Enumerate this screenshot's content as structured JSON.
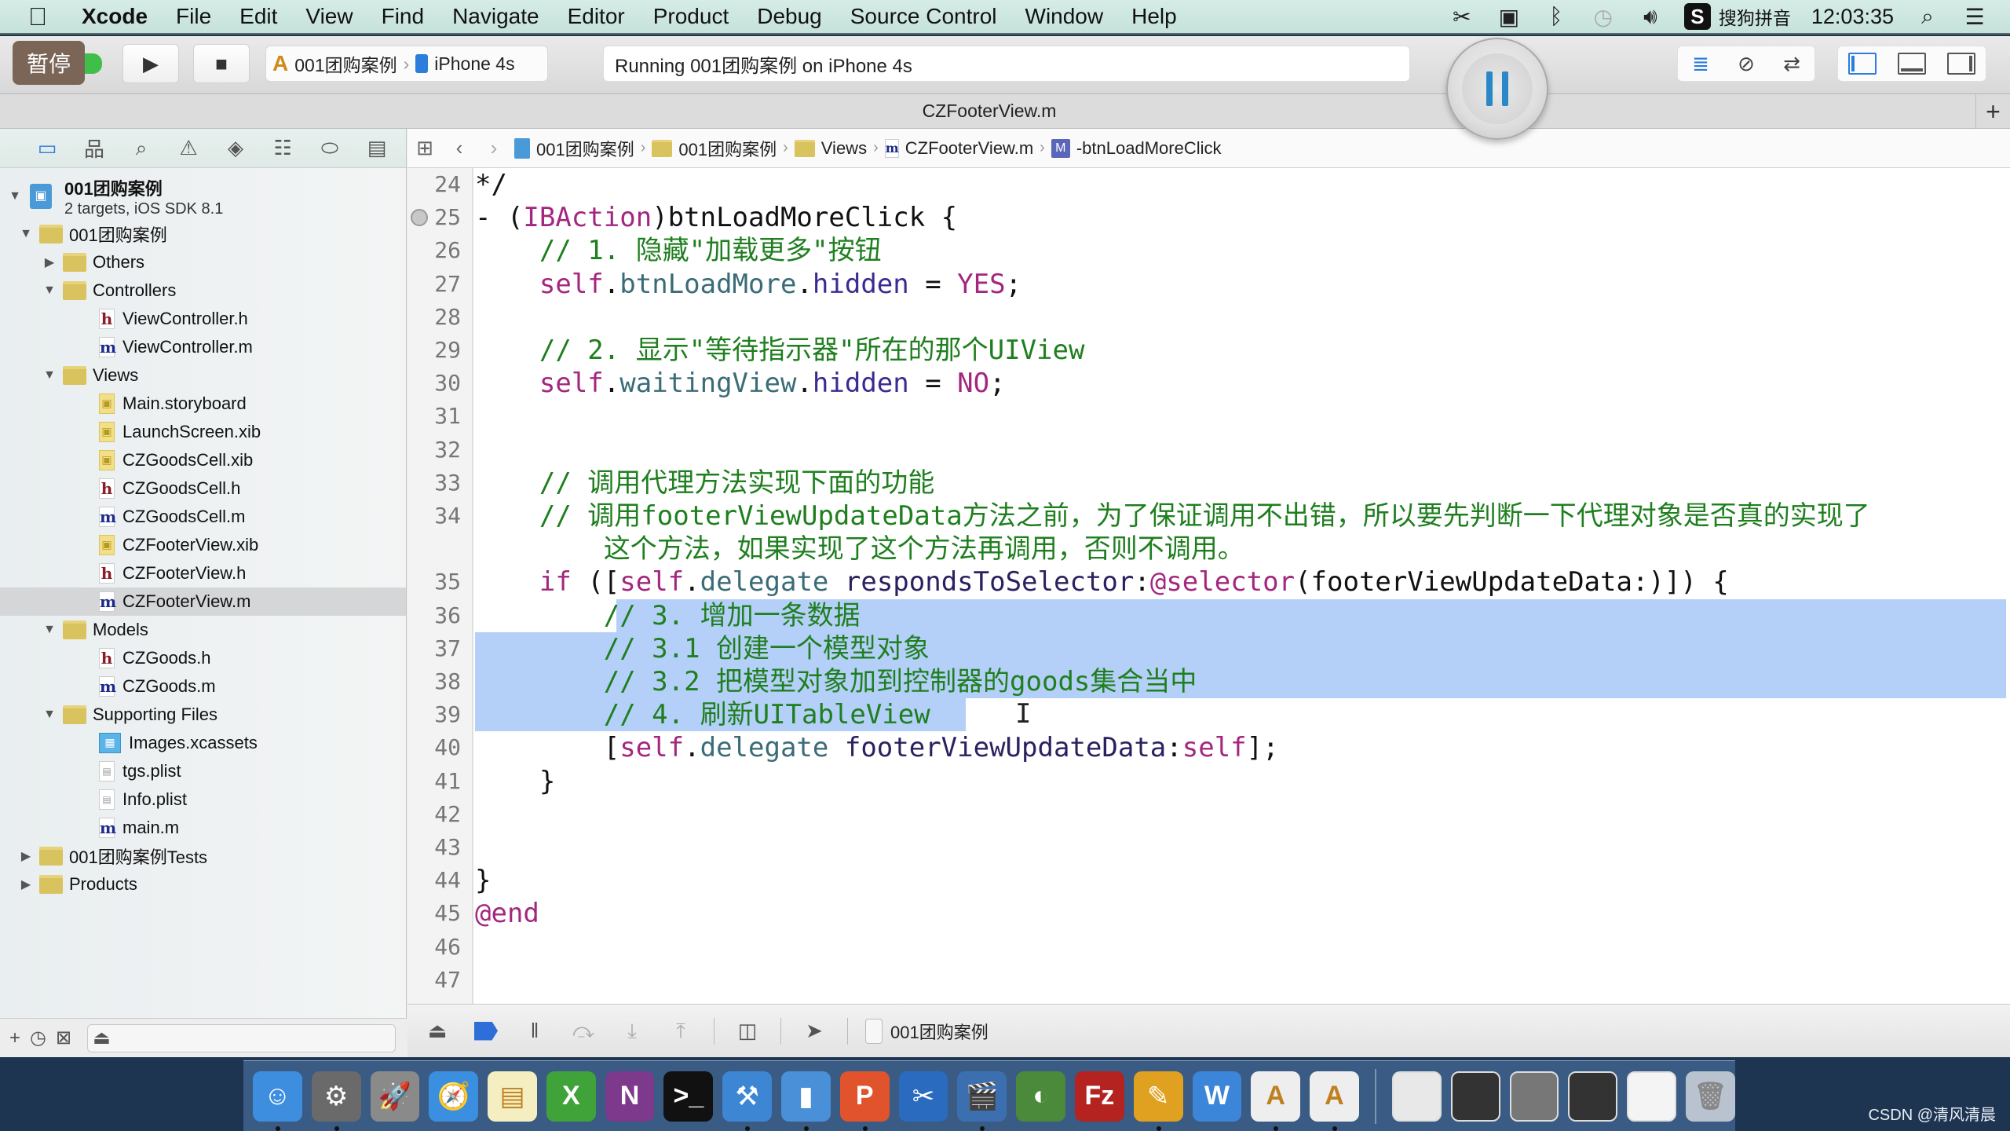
{
  "menubar": {
    "app": "Xcode",
    "menus": [
      "File",
      "Edit",
      "View",
      "Find",
      "Navigate",
      "Editor",
      "Product",
      "Debug",
      "Source Control",
      "Window",
      "Help"
    ],
    "tray": {
      "icons": [
        "scissors-icon",
        "video-camera-icon",
        "bluetooth-icon",
        "time-machine-icon",
        "volume-icon"
      ],
      "ime_badge": "S",
      "ime_label": "搜狗拼音",
      "clock": "12:03:35"
    }
  },
  "toolbar": {
    "pause_tag": "暂停",
    "scheme": "001团购案例",
    "device": "iPhone 4s",
    "status": "Running 001团购案例 on iPhone 4s"
  },
  "tab": {
    "title": "CZFooterView.m",
    "add_label": "+"
  },
  "navigator": {
    "project": {
      "name": "001团购案例",
      "subtitle": "2 targets, iOS SDK 8.1"
    },
    "items": [
      {
        "label": "001团购案例",
        "kind": "folder",
        "depth": 1,
        "open": true
      },
      {
        "label": "Others",
        "kind": "folder",
        "depth": 2,
        "open": false
      },
      {
        "label": "Controllers",
        "kind": "folder",
        "depth": 2,
        "open": true
      },
      {
        "label": "ViewController.h",
        "kind": "h",
        "depth": 3
      },
      {
        "label": "ViewController.m",
        "kind": "m",
        "depth": 3
      },
      {
        "label": "Views",
        "kind": "folder",
        "depth": 2,
        "open": true
      },
      {
        "label": "Main.storyboard",
        "kind": "xib",
        "depth": 3
      },
      {
        "label": "LaunchScreen.xib",
        "kind": "xib",
        "depth": 3
      },
      {
        "label": "CZGoodsCell.xib",
        "kind": "xib",
        "depth": 3
      },
      {
        "label": "CZGoodsCell.h",
        "kind": "h",
        "depth": 3
      },
      {
        "label": "CZGoodsCell.m",
        "kind": "m",
        "depth": 3
      },
      {
        "label": "CZFooterView.xib",
        "kind": "xib",
        "depth": 3
      },
      {
        "label": "CZFooterView.h",
        "kind": "h",
        "depth": 3
      },
      {
        "label": "CZFooterView.m",
        "kind": "m",
        "depth": 3,
        "selected": true
      },
      {
        "label": "Models",
        "kind": "folder",
        "depth": 2,
        "open": true
      },
      {
        "label": "CZGoods.h",
        "kind": "h",
        "depth": 3
      },
      {
        "label": "CZGoods.m",
        "kind": "m",
        "depth": 3
      },
      {
        "label": "Supporting Files",
        "kind": "folder",
        "depth": 2,
        "open": true
      },
      {
        "label": "Images.xcassets",
        "kind": "xcassets",
        "depth": 3
      },
      {
        "label": "tgs.plist",
        "kind": "plist",
        "depth": 3
      },
      {
        "label": "Info.plist",
        "kind": "plist",
        "depth": 3
      },
      {
        "label": "main.m",
        "kind": "m",
        "depth": 3
      },
      {
        "label": "001团购案例Tests",
        "kind": "folder",
        "depth": 1,
        "open": false
      },
      {
        "label": "Products",
        "kind": "folder",
        "depth": 1,
        "open": false
      }
    ]
  },
  "jumpbar": {
    "crumbs": [
      "001团购案例",
      "001团购案例",
      "Views",
      "CZFooterView.m",
      "-btnLoadMoreClick"
    ]
  },
  "editor": {
    "lines": [
      {
        "n": "24",
        "html": "*/"
      },
      {
        "n": "25",
        "breakpoint": true,
        "html": "- (<span class=\"c-kw\">IBAction</span>)btnLoadMoreClick {"
      },
      {
        "n": "26",
        "html": "    <span class=\"c-com\">// 1. 隐藏\"加载更多\"按钮</span>"
      },
      {
        "n": "27",
        "html": "    <span class=\"c-kw\">self</span>.<span class=\"c-var\">btnLoadMore</span>.<span class=\"c-prop\">hidden</span> = <span class=\"c-kw\">YES</span>;"
      },
      {
        "n": "28",
        "html": ""
      },
      {
        "n": "29",
        "html": "    <span class=\"c-com\">// 2. 显示\"等待指示器\"所在的那个UIView</span>"
      },
      {
        "n": "30",
        "html": "    <span class=\"c-kw\">self</span>.<span class=\"c-var\">waitingView</span>.<span class=\"c-prop\">hidden</span> = <span class=\"c-kw\">NO</span>;"
      },
      {
        "n": "31",
        "html": ""
      },
      {
        "n": "32",
        "html": ""
      },
      {
        "n": "33",
        "html": "    <span class=\"c-com\">// 调用代理方法实现下面的功能</span>"
      },
      {
        "n": "34",
        "html": "    <span class=\"c-com\">// 调用footerViewUpdateData方法之前，为了保证调用不出错，所以要先判断一下代理对象是否真的实现了</span>"
      },
      {
        "n": "",
        "html": "        <span class=\"c-com\">这个方法，如果实现了这个方法再调用，否则不调用。</span>"
      },
      {
        "n": "35",
        "html": "    <span class=\"c-kw\">if</span> ([<span class=\"c-kw\">self</span>.<span class=\"c-var\">delegate</span> <span class=\"c-meth\">respondsToSelector</span>:<span class=\"c-kw\">@selector</span>(footerViewUpdateData:)]) {"
      },
      {
        "n": "36",
        "html": "        <span class=\"c-com\">// 3. 增加一条数据</span>"
      },
      {
        "n": "37",
        "html": "        <span class=\"c-com\">// 3.1 创建一个模型对象</span>"
      },
      {
        "n": "38",
        "html": "        <span class=\"c-com\">// 3.2 把模型对象加到控制器的goods集合当中</span>"
      },
      {
        "n": "39",
        "html": "        <span class=\"c-com\">// 4. 刷新UITableView</span>"
      },
      {
        "n": "40",
        "html": "        [<span class=\"c-kw\">self</span>.<span class=\"c-var\">delegate</span> <span class=\"c-meth\">footerViewUpdateData</span>:<span class=\"c-kw\">self</span>];"
      },
      {
        "n": "41",
        "html": "    }"
      },
      {
        "n": "42",
        "html": ""
      },
      {
        "n": "43",
        "html": ""
      },
      {
        "n": "44",
        "html": "}"
      },
      {
        "n": "45",
        "html": "<span class=\"c-kw\">@end</span>"
      },
      {
        "n": "46",
        "html": ""
      },
      {
        "n": "47",
        "html": ""
      }
    ],
    "selection": {
      "from_line": "36",
      "to_line": "39"
    }
  },
  "debugbar": {
    "process": "001团购案例"
  },
  "dock": {
    "apps": [
      {
        "name": "finder",
        "glyph": "☺",
        "color": "#3e8ee0",
        "running": true
      },
      {
        "name": "system-preferences",
        "glyph": "⚙",
        "color": "#6a6a6a",
        "running": true
      },
      {
        "name": "launchpad",
        "glyph": "🚀",
        "color": "#8a8a8a",
        "running": false
      },
      {
        "name": "safari",
        "glyph": "🧭",
        "color": "#3b8fe0",
        "running": false
      },
      {
        "name": "notes",
        "glyph": "▤",
        "color": "#f4eec0",
        "running": false
      },
      {
        "name": "excel",
        "glyph": "X",
        "color": "#3fa33a",
        "running": false
      },
      {
        "name": "onenote",
        "glyph": "N",
        "color": "#7d3a8c",
        "running": false
      },
      {
        "name": "terminal",
        "glyph": ">_",
        "color": "#111111",
        "running": false
      },
      {
        "name": "xcode",
        "glyph": "⚒",
        "color": "#3d86d4",
        "running": true
      },
      {
        "name": "simulator",
        "glyph": "▮",
        "color": "#4a90d8",
        "running": true
      },
      {
        "name": "powerpoint",
        "glyph": "P",
        "color": "#e0532c",
        "running": true
      },
      {
        "name": "snipping-tool",
        "glyph": "✂",
        "color": "#2b6bbf",
        "running": false
      },
      {
        "name": "video-editor",
        "glyph": "🎬",
        "color": "#3c6fb0",
        "running": true
      },
      {
        "name": "recorder",
        "glyph": "◐",
        "color": "#4a8a3a",
        "running": false
      },
      {
        "name": "filezilla",
        "glyph": "Fz",
        "color": "#b4231f",
        "running": false
      },
      {
        "name": "instruments",
        "glyph": "✎",
        "color": "#e0a020",
        "running": true
      },
      {
        "name": "word-doc",
        "glyph": "W",
        "color": "#3b86d8",
        "running": false
      },
      {
        "name": "pdf-preview-1",
        "glyph": "A",
        "color": "#eeeeee",
        "running": true
      },
      {
        "name": "pdf-preview-2",
        "glyph": "A",
        "color": "#eeeeee",
        "running": true
      }
    ],
    "docs": [
      {
        "name": "doc-thumb-1",
        "color": "#e8e8e8"
      },
      {
        "name": "doc-thumb-2",
        "color": "#333333"
      },
      {
        "name": "doc-thumb-3",
        "color": "#777777"
      },
      {
        "name": "doc-thumb-4",
        "color": "#333333"
      },
      {
        "name": "doc-thumb-5",
        "color": "#f4f4f4"
      }
    ],
    "trash": "trash-icon"
  },
  "watermark": "CSDN @清风清晨"
}
